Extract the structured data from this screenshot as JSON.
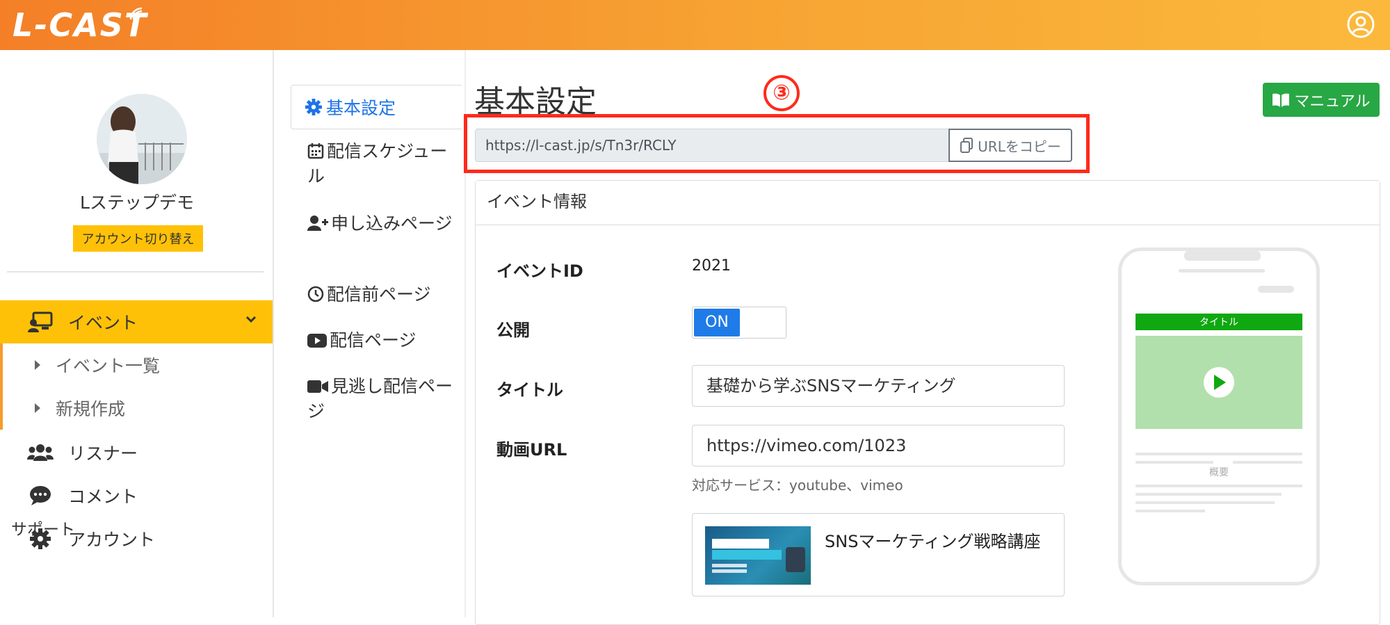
{
  "header": {
    "logo": "L-CAST"
  },
  "sidebar": {
    "profile_name": "Lステップデモ",
    "switch_account": "アカウント切り替え",
    "items": [
      {
        "label": "イベント"
      },
      {
        "label": "イベント一覧"
      },
      {
        "label": "新規作成"
      },
      {
        "label": "リスナー"
      },
      {
        "label": "コメント"
      },
      {
        "label": "アカウント"
      }
    ],
    "support": "サポート"
  },
  "submenu": {
    "items": [
      {
        "label": "基本設定"
      },
      {
        "label": "配信スケジュール"
      },
      {
        "label": "申し込みページ"
      },
      {
        "label": "配信前ページ"
      },
      {
        "label": "配信ページ"
      },
      {
        "label": "見逃し配信ページ"
      }
    ]
  },
  "main": {
    "title": "基本設定",
    "annotation": "③",
    "manual_label": "マニュアル",
    "url_value": "https://l-cast.jp/s/Tn3r/RCLY",
    "copy_label": "URLをコピー",
    "card_title": "イベント情報",
    "fields": {
      "event_id_label": "イベントID",
      "event_id_value": "2021",
      "public_label": "公開",
      "public_toggle": "ON",
      "title_label": "タイトル",
      "title_value": "基礎から学ぶSNSマーケティング",
      "video_label": "動画URL",
      "video_value": "https://vimeo.com/1023",
      "video_hint": "対応サービス：youtube、vimeo",
      "preview_title": "SNSマーケティング戦略講座"
    }
  },
  "phone": {
    "title_bar": "タイトル",
    "summary": "概要"
  },
  "colors": {
    "accent": "#ffc107",
    "link": "#1e73e8",
    "annotation": "#ff2a1a",
    "success": "#28a745"
  }
}
